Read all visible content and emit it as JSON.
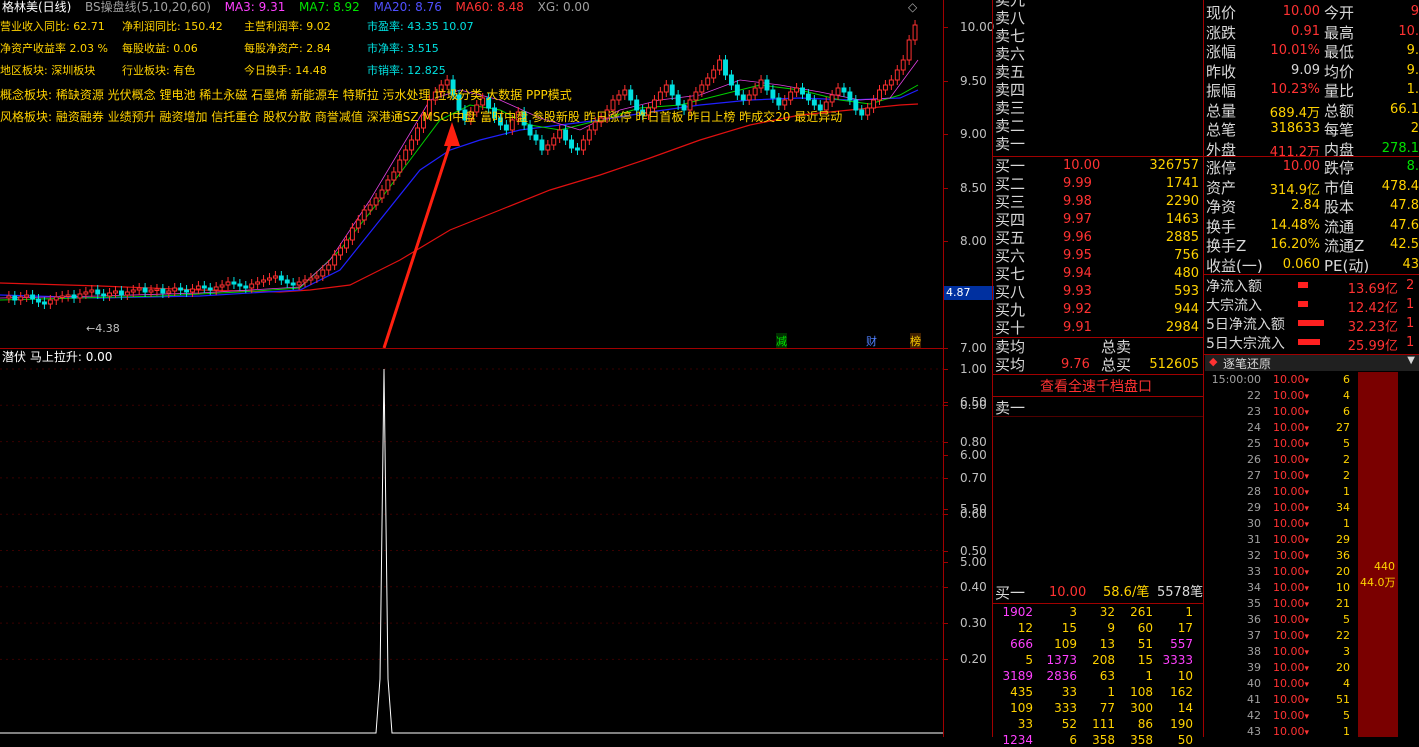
{
  "chart_header": {
    "title": "格林美(日线)",
    "indicator": "BS操盘线(5,10,20,60)",
    "ma3": "MA3: 9.31",
    "ma7": "MA7: 8.92",
    "ma20": "MA20: 8.76",
    "ma60": "MA60: 8.48",
    "xg": "XG: 0.00"
  },
  "fundamentals": [
    {
      "k": "营业收入同比: 62.71",
      "k2": "净利润同比: 150.42",
      "k3": "主营利润率: 9.02",
      "k4": "市盈率: 43.35 10.07"
    },
    {
      "k": "净资产收益率 2.03 %",
      "k2": "每股收益: 0.06",
      "k3": "每股净资产: 2.84",
      "k4": "市净率: 3.515"
    },
    {
      "k": "地区板块: 深圳板块",
      "k2": "行业板块: 有色",
      "k3": "今日换手: 14.48",
      "k4": "市销率: 12.825"
    }
  ],
  "concept": "概念板块: 稀缺资源 光伏概念 锂电池 稀土永磁 石墨烯 新能源车 特斯拉 污水处理 垃圾分类 大数据 PPP模式",
  "style": "风格板块: 融资融券 业绩预升 融资增加 信托重仓 股权分散 商誉减值 深港通SZ MSCI中盘 富时中盘 参股新股 昨日涨停 昨日首板 昨日上榜 昨成交20 最近异动",
  "price_axis": [
    "10.00",
    "9.50",
    "9.00",
    "8.50",
    "8.00",
    "7.50",
    "7.00",
    "6.50",
    "6.00",
    "5.50",
    "5.00"
  ],
  "current_tag": "4.87",
  "low_label": "4.38",
  "bottom_tags": {
    "a": "减",
    "b": "财",
    "c": "榜"
  },
  "sub_header": {
    "name": "潜伏",
    "line": "马上拉升: 0.00"
  },
  "sub_axis": [
    "1.00",
    "0.90",
    "0.80",
    "0.70",
    "0.60",
    "0.50",
    "0.40",
    "0.30",
    "0.20"
  ],
  "sell_levels": [
    "卖九",
    "卖八",
    "卖七",
    "卖六",
    "卖五",
    "卖四",
    "卖三",
    "卖二",
    "卖一"
  ],
  "buy_levels": [
    {
      "l": "买一",
      "p": "10.00",
      "v": "326757"
    },
    {
      "l": "买二",
      "p": "9.99",
      "v": "1741"
    },
    {
      "l": "买三",
      "p": "9.98",
      "v": "2290"
    },
    {
      "l": "买四",
      "p": "9.97",
      "v": "1463"
    },
    {
      "l": "买五",
      "p": "9.96",
      "v": "2885"
    },
    {
      "l": "买六",
      "p": "9.95",
      "v": "756"
    },
    {
      "l": "买七",
      "p": "9.94",
      "v": "480"
    },
    {
      "l": "买八",
      "p": "9.93",
      "v": "593"
    },
    {
      "l": "买九",
      "p": "9.92",
      "v": "944"
    },
    {
      "l": "买十",
      "p": "9.91",
      "v": "2984"
    }
  ],
  "avg": {
    "sell_label": "卖均",
    "total_sell": "总卖",
    "buy_label": "买均",
    "buy_price": "9.76",
    "total_buy": "总买",
    "total_buy_v": "512605"
  },
  "full_depth_button": "查看全速千档盘口",
  "queue_sell_label": "卖一",
  "queue_buy": {
    "label": "买一",
    "price": "10.00",
    "per": "58.6/笔",
    "count": "5578笔"
  },
  "queue_rows": [
    [
      "1902",
      "3",
      "32",
      "261",
      "1"
    ],
    [
      "12",
      "15",
      "9",
      "60",
      "17"
    ],
    [
      "666",
      "109",
      "13",
      "51",
      "557"
    ],
    [
      "5",
      "1373",
      "208",
      "15",
      "3333"
    ],
    [
      "3189",
      "2836",
      "63",
      "1",
      "10"
    ],
    [
      "435",
      "33",
      "1",
      "108",
      "162"
    ],
    [
      "109",
      "333",
      "77",
      "300",
      "14"
    ],
    [
      "33",
      "52",
      "111",
      "86",
      "190"
    ],
    [
      "1234",
      "6",
      "358",
      "358",
      "50"
    ]
  ],
  "quote": [
    {
      "k": "现价",
      "v": "10.00",
      "k2": "今开",
      "v2": "9"
    },
    {
      "k": "涨跌",
      "v": "0.91",
      "k2": "最高",
      "v2": "10."
    },
    {
      "k": "涨幅",
      "v": "10.01%",
      "k2": "最低",
      "v2": "9."
    },
    {
      "k": "昨收",
      "v": "9.09",
      "k2": "均价",
      "v2": "9."
    },
    {
      "k": "振幅",
      "v": "10.23%",
      "k2": "量比",
      "v2": "1."
    },
    {
      "k": "总量",
      "v": "689.4万",
      "k2": "总额",
      "v2": "66.1"
    },
    {
      "k": "总笔",
      "v": "318633",
      "k2": "每笔",
      "v2": "2"
    },
    {
      "k": "外盘",
      "v": "411.2万",
      "k2": "内盘",
      "v2": "278.1"
    }
  ],
  "quote2": [
    {
      "k": "涨停",
      "v": "10.00",
      "k2": "跌停",
      "v2": "8."
    },
    {
      "k": "资产",
      "v": "314.9亿",
      "k2": "市值",
      "v2": "478.4"
    },
    {
      "k": "净资",
      "v": "2.84",
      "k2": "股本",
      "v2": "47.8"
    },
    {
      "k": "换手",
      "v": "14.48%",
      "k2": "流通",
      "v2": "47.6"
    },
    {
      "k": "换手Z",
      "v": "16.20%",
      "k2": "流通Z",
      "v2": "42.5"
    },
    {
      "k": "收益(一)",
      "v": "0.060",
      "k2": "PE(动)",
      "v2": "43"
    }
  ],
  "flows": [
    {
      "k": "净流入额",
      "v": "13.69亿",
      "v2": "2"
    },
    {
      "k": "大宗流入",
      "v": "12.42亿",
      "v2": "1"
    },
    {
      "k": "5日净流入额",
      "v": "32.23亿",
      "v2": "1"
    },
    {
      "k": "5日大宗流入",
      "v": "25.99亿",
      "v2": "1"
    }
  ],
  "ticks_title": "逐笔还原",
  "ticks": [
    {
      "t": "15:00:00",
      "p": "10.00",
      "n": "6"
    },
    {
      "t": "22",
      "p": "10.00",
      "n": "4"
    },
    {
      "t": "23",
      "p": "10.00",
      "n": "6"
    },
    {
      "t": "24",
      "p": "10.00",
      "n": "27"
    },
    {
      "t": "25",
      "p": "10.00",
      "n": "5"
    },
    {
      "t": "26",
      "p": "10.00",
      "n": "2"
    },
    {
      "t": "27",
      "p": "10.00",
      "n": "2"
    },
    {
      "t": "28",
      "p": "10.00",
      "n": "1"
    },
    {
      "t": "29",
      "p": "10.00",
      "n": "34"
    },
    {
      "t": "30",
      "p": "10.00",
      "n": "1"
    },
    {
      "t": "31",
      "p": "10.00",
      "n": "29"
    },
    {
      "t": "32",
      "p": "10.00",
      "n": "36"
    },
    {
      "t": "33",
      "p": "10.00",
      "n": "20"
    },
    {
      "t": "34",
      "p": "10.00",
      "n": "10"
    },
    {
      "t": "35",
      "p": "10.00",
      "n": "21"
    },
    {
      "t": "36",
      "p": "10.00",
      "n": "5"
    },
    {
      "t": "37",
      "p": "10.00",
      "n": "22"
    },
    {
      "t": "38",
      "p": "10.00",
      "n": "3"
    },
    {
      "t": "39",
      "p": "10.00",
      "n": "20"
    },
    {
      "t": "40",
      "p": "10.00",
      "n": "4"
    },
    {
      "t": "41",
      "p": "10.00",
      "n": "51"
    },
    {
      "t": "42",
      "p": "10.00",
      "n": "5"
    },
    {
      "t": "43",
      "p": "10.00",
      "n": "1"
    }
  ],
  "big_order": {
    "a": "440",
    "b": "44.0万"
  }
}
